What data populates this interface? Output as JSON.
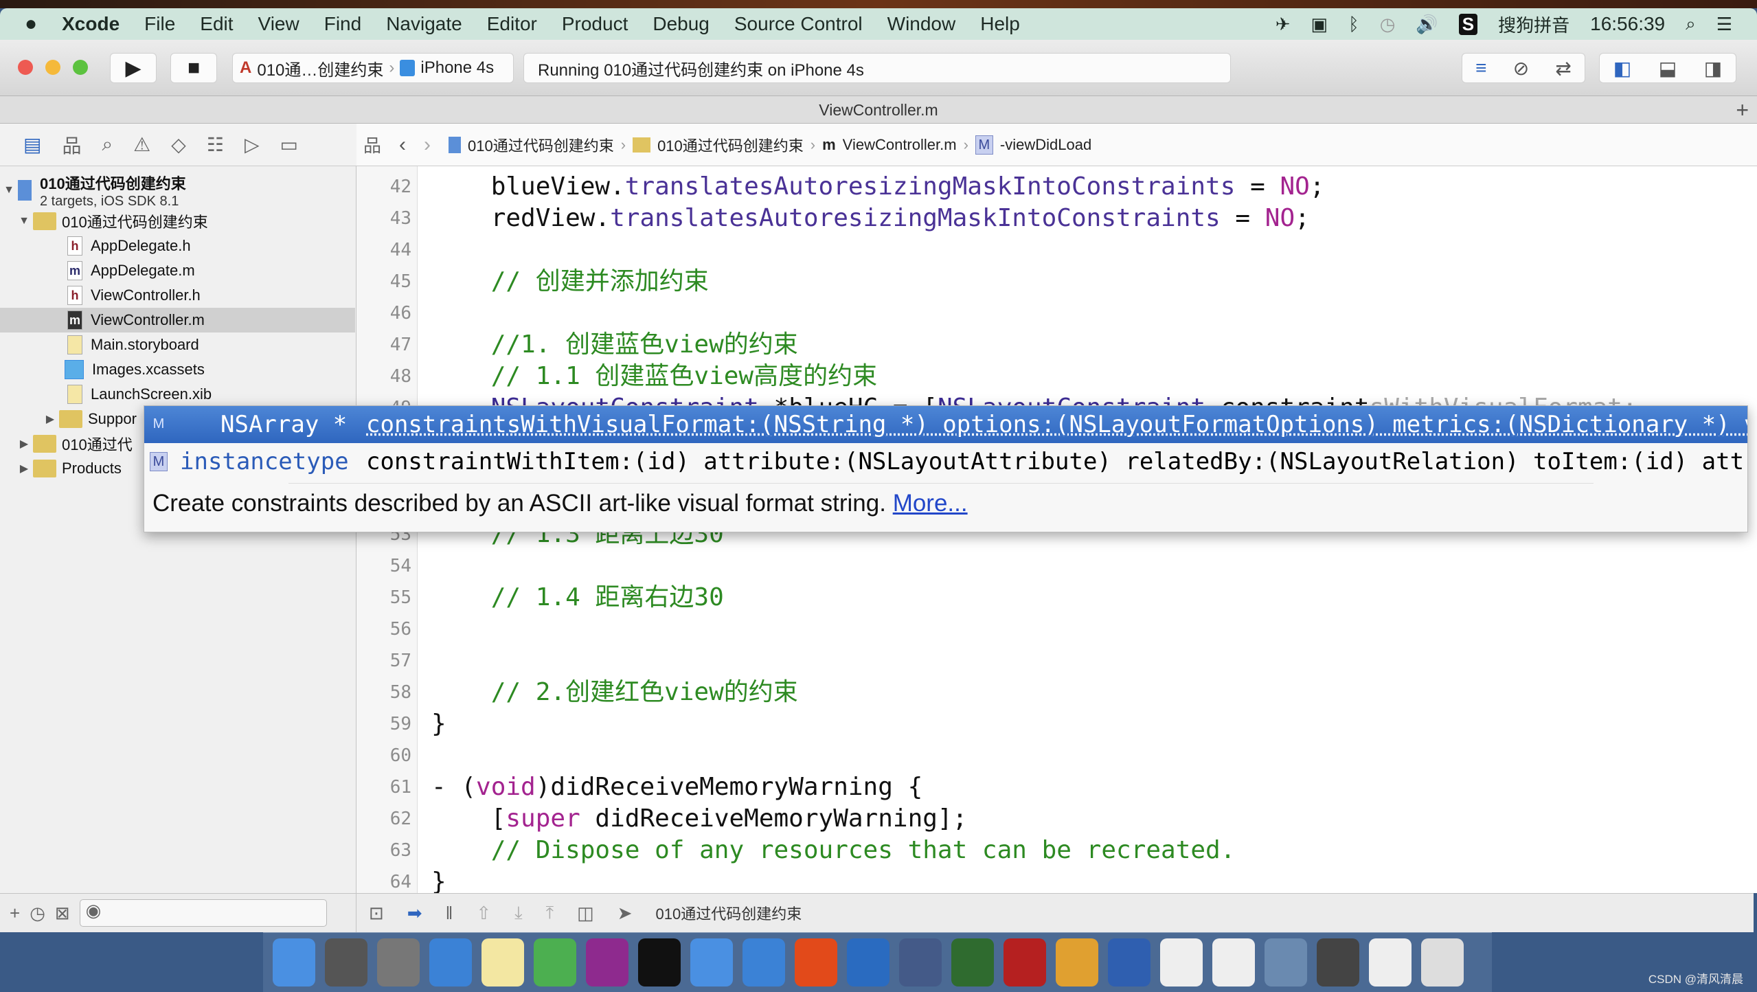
{
  "menubar": {
    "app": "Xcode",
    "items": [
      "File",
      "Edit",
      "View",
      "Find",
      "Navigate",
      "Editor",
      "Product",
      "Debug",
      "Source Control",
      "Window",
      "Help"
    ],
    "input_method": "搜狗拼音",
    "clock": "16:56:39"
  },
  "toolbar": {
    "scheme": "010通…创建约束",
    "device": "iPhone 4s",
    "status": "Running 010通过代码创建约束 on iPhone 4s"
  },
  "tab": {
    "title": "ViewController.m",
    "add": "+"
  },
  "jumpbar": [
    "010通过代码创建约束",
    "010通过代码创建约束",
    "ViewController.m",
    "-viewDidLoad"
  ],
  "navigator": {
    "project": {
      "name": "010通过代码创建约束",
      "subtitle": "2 targets, iOS SDK 8.1"
    },
    "items": [
      {
        "label": "010通过代码创建约束",
        "type": "folder",
        "expanded": true
      },
      {
        "label": "AppDelegate.h",
        "type": "h"
      },
      {
        "label": "AppDelegate.m",
        "type": "m"
      },
      {
        "label": "ViewController.h",
        "type": "h"
      },
      {
        "label": "ViewController.m",
        "type": "m",
        "selected": true
      },
      {
        "label": "Main.storyboard",
        "type": "storyboard"
      },
      {
        "label": "Images.xcassets",
        "type": "assets"
      },
      {
        "label": "LaunchScreen.xib",
        "type": "xib"
      },
      {
        "label": "Suppor",
        "type": "folder"
      },
      {
        "label": "010通过代",
        "type": "folder"
      },
      {
        "label": "Products",
        "type": "folder"
      }
    ]
  },
  "code": {
    "lines": [
      {
        "n": "42",
        "segs": [
          [
            "    blueView.",
            ""
          ],
          [
            "translatesAutoresizingMaskIntoConstraints",
            "meth"
          ],
          [
            " = ",
            ""
          ],
          [
            "NO",
            "kw"
          ],
          [
            ";",
            ""
          ]
        ]
      },
      {
        "n": "43",
        "segs": [
          [
            "    redView.",
            ""
          ],
          [
            "translatesAutoresizingMaskIntoConstraints",
            "meth"
          ],
          [
            " = ",
            ""
          ],
          [
            "NO",
            "kw"
          ],
          [
            ";",
            ""
          ]
        ]
      },
      {
        "n": "44",
        "segs": []
      },
      {
        "n": "45",
        "segs": [
          [
            "    // 创建并添加约束",
            "cm"
          ]
        ]
      },
      {
        "n": "46",
        "segs": []
      },
      {
        "n": "47",
        "segs": [
          [
            "    //1. 创建蓝色view的约束",
            "cm"
          ]
        ]
      },
      {
        "n": "48",
        "segs": [
          [
            "    // 1.1 创建蓝色view高度的约束",
            "cm"
          ]
        ]
      },
      {
        "n": "49",
        "segs": [
          [
            "    ",
            ""
          ],
          [
            "NSLayoutConstraint",
            "cls"
          ],
          [
            " *blueHC = [",
            ""
          ],
          [
            "NSLayoutConstraint",
            "cls"
          ],
          [
            " ",
            ""
          ],
          [
            "constraint",
            "und"
          ],
          [
            "sWithVisualFormat:",
            "ghost"
          ]
        ]
      },
      {
        "n": "50",
        "segs": []
      },
      {
        "n": "51",
        "segs": []
      },
      {
        "n": "52",
        "segs": []
      },
      {
        "n": "53",
        "segs": [
          [
            "    // 1.3 距离上边30",
            "cm"
          ]
        ]
      },
      {
        "n": "54",
        "segs": []
      },
      {
        "n": "55",
        "segs": [
          [
            "    // 1.4 距离右边30",
            "cm"
          ]
        ]
      },
      {
        "n": "56",
        "segs": []
      },
      {
        "n": "57",
        "segs": []
      },
      {
        "n": "58",
        "segs": [
          [
            "    // 2.创建红色view的约束",
            "cm"
          ]
        ]
      },
      {
        "n": "59",
        "segs": [
          [
            "}",
            ""
          ]
        ]
      },
      {
        "n": "60",
        "segs": []
      },
      {
        "n": "61",
        "segs": [
          [
            "- (",
            ""
          ],
          [
            "void",
            "kw"
          ],
          [
            ")didReceiveMemoryWarning {",
            ""
          ]
        ]
      },
      {
        "n": "62",
        "segs": [
          [
            "    [",
            ""
          ],
          [
            "super",
            "kw"
          ],
          [
            " didReceiveMemoryWarning];",
            ""
          ]
        ]
      },
      {
        "n": "63",
        "segs": [
          [
            "    // Dispose of any resources that can be recreated.",
            "cm"
          ]
        ]
      },
      {
        "n": "64",
        "segs": [
          [
            "}",
            ""
          ]
        ]
      }
    ]
  },
  "autocomplete": {
    "items": [
      {
        "badge": "M",
        "ret": "NSArray *",
        "sig": "constraintsWithVisualFormat:(NSString *) options:(NSLayoutFormatOptions) metrics:(NSDictionary *) views:(NSDictionary *)",
        "selected": true
      },
      {
        "badge": "M",
        "ret": "instancetype",
        "sig": "constraintWithItem:(id) attribute:(NSLayoutAttribute) relatedBy:(NSLayoutRelation) toItem:(id) attribute:(NSLayoutAttribute)"
      }
    ],
    "description": "Create constraints described by an ASCII art-like visual format string.",
    "more": "More..."
  },
  "debugbar": {
    "target": "010通过代码创建约束"
  },
  "dock": [
    "finder",
    "system-preferences",
    "launchpad",
    "safari",
    "notes",
    "excel",
    "onenote",
    "terminal",
    "xcode",
    "folder",
    "powerpoint",
    "scissors",
    "movie",
    "growl",
    "filezilla",
    "instruments",
    "word",
    "pages-a",
    "pages-b",
    "preview",
    "screen",
    "document",
    "trash"
  ],
  "watermark": "CSDN @清风清晨",
  "colors": {
    "accent": "#2f66bf",
    "comment": "#2d8a22",
    "keyword": "#a3238f"
  }
}
